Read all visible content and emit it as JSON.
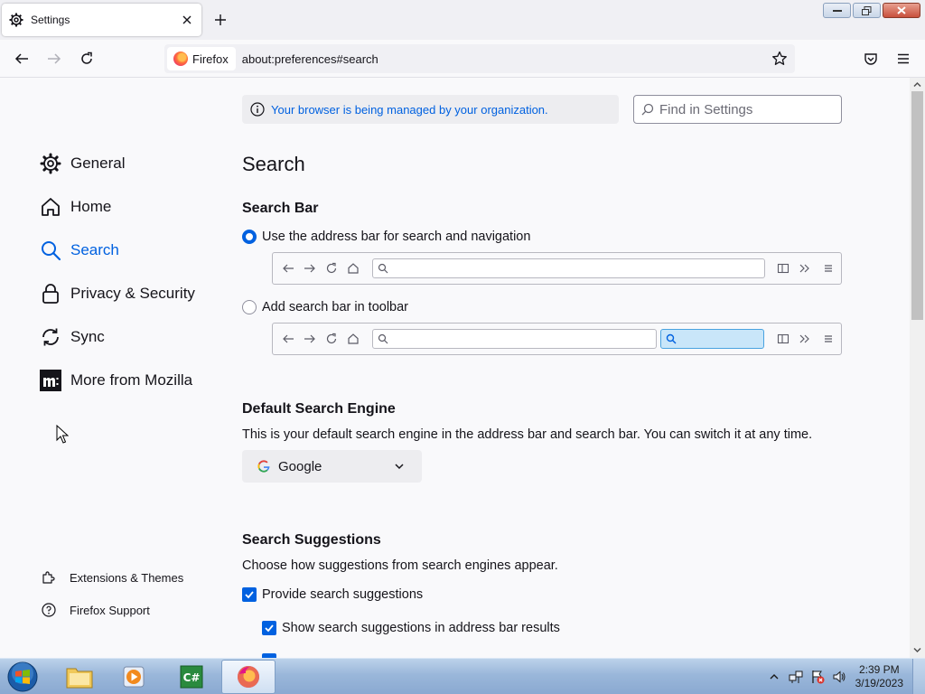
{
  "tab": {
    "title": "Settings"
  },
  "navbar": {
    "identity_label": "Firefox",
    "url": "about:preferences#search"
  },
  "sidebar": {
    "categories": [
      {
        "label": "General",
        "icon": "gear-icon"
      },
      {
        "label": "Home",
        "icon": "home-icon"
      },
      {
        "label": "Search",
        "icon": "search-icon",
        "selected": true
      },
      {
        "label": "Privacy & Security",
        "icon": "lock-icon"
      },
      {
        "label": "Sync",
        "icon": "sync-icon"
      },
      {
        "label": "More from Mozilla",
        "icon": "mozilla-icon"
      }
    ],
    "footer": [
      {
        "label": "Extensions & Themes",
        "icon": "puzzle-icon"
      },
      {
        "label": "Firefox Support",
        "icon": "help-icon"
      }
    ]
  },
  "policies": {
    "text": "Your browser is being managed by your organization."
  },
  "find": {
    "placeholder": "Find in Settings"
  },
  "main": {
    "title": "Search",
    "search_bar": {
      "heading": "Search Bar",
      "option_address": "Use the address bar for search and navigation",
      "option_toolbar": "Add search bar in toolbar",
      "selected": "address"
    },
    "default_engine": {
      "heading": "Default Search Engine",
      "description": "This is your default search engine in the address bar and search bar. You can switch it at any time.",
      "selected": "Google"
    },
    "suggestions": {
      "heading": "Search Suggestions",
      "description": "Choose how suggestions from search engines appear.",
      "provide_label": "Provide search suggestions",
      "provide_checked": true,
      "show_in_address_label": "Show search suggestions in address bar results",
      "show_in_address_checked": true
    }
  },
  "taskbar": {
    "time": "2:39 PM",
    "date": "3/19/2023"
  },
  "colors": {
    "accent": "#0061e0",
    "text": "#15141a",
    "background": "#f9f9fb"
  }
}
